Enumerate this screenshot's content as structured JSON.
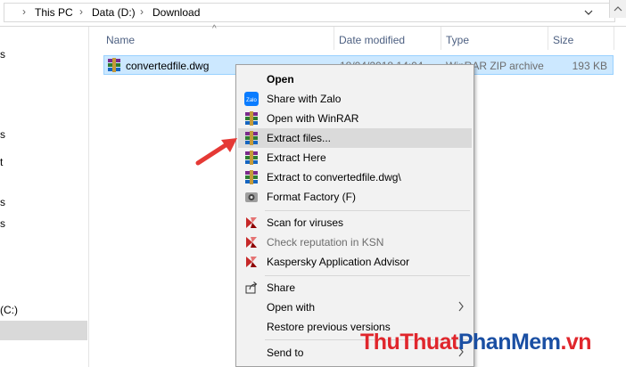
{
  "address": {
    "crumbs": [
      "This PC",
      "Data (D:)",
      "Download"
    ]
  },
  "nav": {
    "fragments": [
      "s",
      "s",
      "t",
      "s",
      "s",
      "(C:)"
    ]
  },
  "columns": {
    "name": "Name",
    "date": "Date modified",
    "type": "Type",
    "size": "Size"
  },
  "file": {
    "name": "convertedfile.dwg",
    "date": "18/04/2018 14:04",
    "type": "WinRAR ZIP archive",
    "size": "193 KB"
  },
  "menu": {
    "items": [
      {
        "label": "Open",
        "icon": "none"
      },
      {
        "label": "Share with Zalo",
        "icon": "zalo-icon"
      },
      {
        "label": "Open with WinRAR",
        "icon": "winrar-icon"
      },
      {
        "label": "Extract files...",
        "icon": "winrar-icon"
      },
      {
        "label": "Extract Here",
        "icon": "winrar-icon"
      },
      {
        "label": "Extract to convertedfile.dwg\\",
        "icon": "winrar-icon"
      },
      {
        "label": "Format Factory (F)",
        "icon": "format-factory-icon"
      },
      {
        "label": "Scan for viruses",
        "icon": "kaspersky-icon"
      },
      {
        "label": "Check reputation in KSN",
        "icon": "kaspersky-icon"
      },
      {
        "label": "Kaspersky Application Advisor",
        "icon": "kaspersky-icon"
      },
      {
        "label": "Share",
        "icon": "share-icon"
      },
      {
        "label": "Open with",
        "icon": "none"
      },
      {
        "label": "Restore previous versions",
        "icon": "none"
      },
      {
        "label": "Send to",
        "icon": "none"
      }
    ]
  },
  "watermark": {
    "part1": "ThuThuat",
    "part2": "PhanMem",
    "part3": ".vn"
  },
  "colors": {
    "selection": "#cce8ff",
    "menu_bg": "#f2f2f2",
    "hover": "#dadada",
    "arrow": "#e53935",
    "watermark_red": "#e0262c",
    "watermark_blue": "#1a4fa3"
  }
}
